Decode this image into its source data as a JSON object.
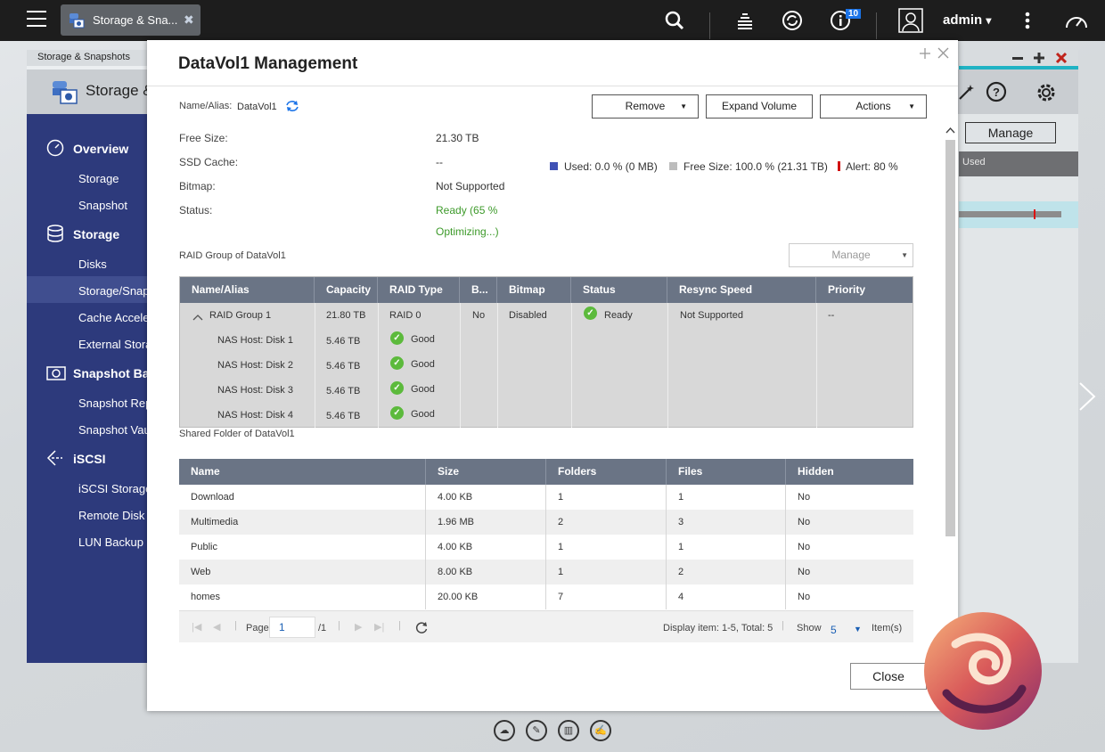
{
  "topbar": {
    "tab_label": "Storage & Sna...",
    "tab_close": "✖",
    "notification_count": "10",
    "user": "admin",
    "user_caret": "▾"
  },
  "bg_window": {
    "title": "Storage & Snapshots",
    "app_name": "Storage &",
    "manage_label": "Manage",
    "used_label": "Used",
    "sidebar": {
      "overview": "Overview",
      "storage_sub": "Storage",
      "snapshot_sub": "Snapshot",
      "storage": "Storage",
      "disks": "Disks",
      "storage_snap": "Storage/Snap",
      "cache": "Cache Accele",
      "external": "External Stora",
      "snapshot_backup": "Snapshot Bac",
      "snapshot_rep": "Snapshot Rep",
      "snapshot_vault": "Snapshot Vau",
      "iscsi": "iSCSI",
      "iscsi_storage": "iSCSI Storage",
      "remote_disk": "Remote Disk",
      "lun_backup": "LUN Backup"
    }
  },
  "modal": {
    "title": "DataVol1  Management",
    "name_label": "Name/Alias:",
    "name_value": "DataVol1",
    "buttons": {
      "remove": "Remove",
      "expand": "Expand Volume",
      "actions": "Actions",
      "close": "Close",
      "caret": "▼"
    },
    "info": {
      "free_size_label": "Free Size:",
      "free_size_value": "21.30 TB",
      "ssd_cache_label": "SSD Cache:",
      "ssd_cache_value": "--",
      "bitmap_label": "Bitmap:",
      "bitmap_value": "Not Supported",
      "status_label": "Status:",
      "status_value_line1": "Ready (65 %",
      "status_value_line2": "Optimizing...)"
    },
    "legend": {
      "used": "Used: 0.0 % (0 MB)",
      "free": "Free Size: 100.0 % (21.31 TB)",
      "alert": "Alert: 80 %",
      "used_color": "#3f51b5",
      "free_color": "#bdbdbd",
      "alert_color": "#d11111"
    },
    "raid_section_label": "RAID Group of DataVol1",
    "raid_manage": "Manage",
    "raid_headers": [
      "Name/Alias",
      "Capacity",
      "RAID Type",
      "B...",
      "Bitmap",
      "Status",
      "Resync Speed",
      "Priority"
    ],
    "raid_group": {
      "name": "RAID Group 1",
      "capacity": "21.80 TB",
      "type": "RAID 0",
      "b": "No",
      "bitmap": "Disabled",
      "status": "Ready",
      "resync": "Not Supported",
      "priority": "--"
    },
    "disks": [
      {
        "name": "NAS Host: Disk 1",
        "capacity": "5.46 TB",
        "status": "Good"
      },
      {
        "name": "NAS Host: Disk 2",
        "capacity": "5.46 TB",
        "status": "Good"
      },
      {
        "name": "NAS Host: Disk 3",
        "capacity": "5.46 TB",
        "status": "Good"
      },
      {
        "name": "NAS Host: Disk 4",
        "capacity": "5.46 TB",
        "status": "Good"
      }
    ],
    "shared_section_label": "Shared Folder of DataVol1",
    "shared_headers": [
      "Name",
      "Size",
      "Folders",
      "Files",
      "Hidden"
    ],
    "shared_rows": [
      [
        "Download",
        "4.00 KB",
        "1",
        "1",
        "No"
      ],
      [
        "Multimedia",
        "1.96 MB",
        "2",
        "3",
        "No"
      ],
      [
        "Public",
        "4.00 KB",
        "1",
        "1",
        "No"
      ],
      [
        "Web",
        "8.00 KB",
        "1",
        "2",
        "No"
      ],
      [
        "homes",
        "20.00 KB",
        "7",
        "4",
        "No"
      ]
    ],
    "pager": {
      "page_label": "Page",
      "page_value": "1",
      "page_total": "/1",
      "display": "Display item: 1-5, Total: 5",
      "show_label": "Show",
      "show_value": "5",
      "items_label": "Item(s)"
    }
  }
}
